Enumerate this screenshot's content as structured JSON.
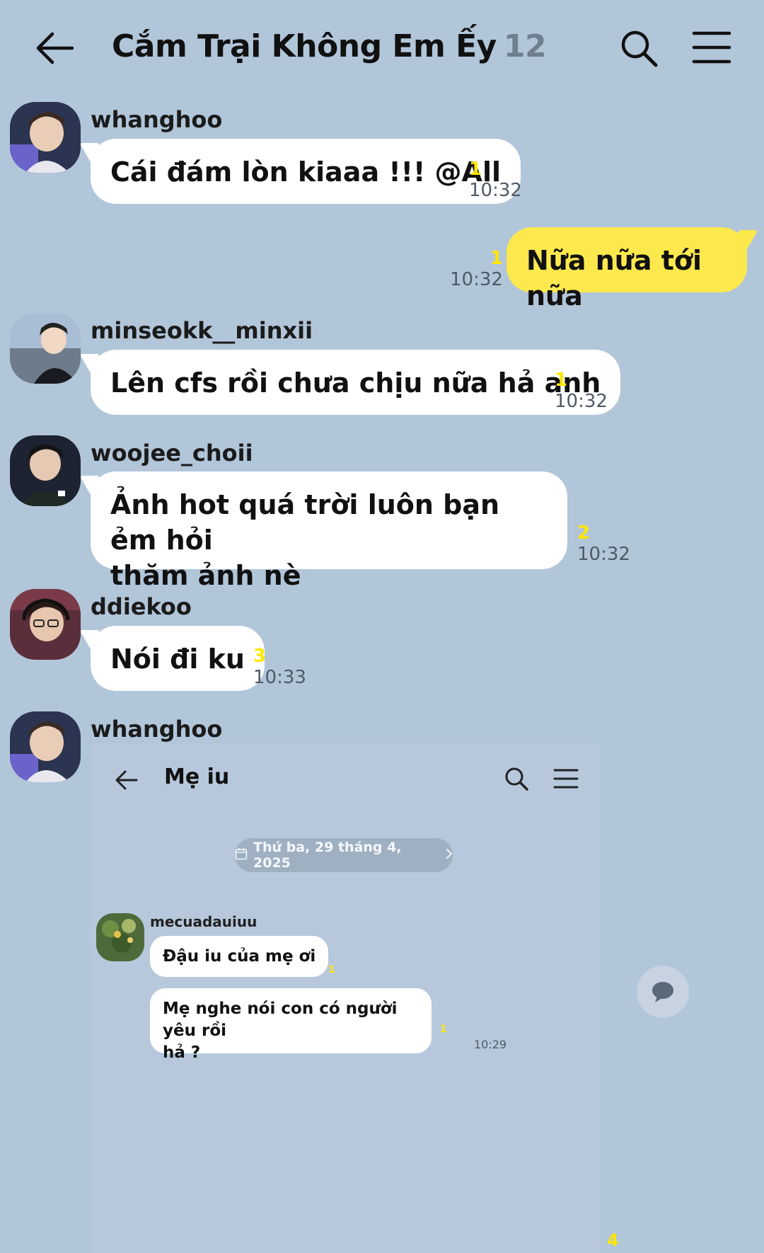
{
  "header": {
    "title": "Cắm Trại Không Em Ếy",
    "member_count": "12",
    "icons": {
      "back": "back-arrow-icon",
      "search": "search-icon",
      "menu": "hamburger-menu-icon"
    }
  },
  "messages": [
    {
      "sender": "whanghoo",
      "text": "Cái đám lòn kiaaa !!! @All",
      "unread": "1",
      "time": "10:32"
    },
    {
      "mine": true,
      "text": "Nữa nữa tới nữa",
      "unread": "1",
      "time": "10:32"
    },
    {
      "sender": "minseokk__minxii",
      "text": "Lên cfs rồi chưa chịu nữa hả anh",
      "unread": "1",
      "time": "10:32"
    },
    {
      "sender": "woojee_choii",
      "text_line1": "Ảnh hot quá trời luôn bạn ẻm hỏi",
      "text_line2": "thăm ảnh nè",
      "unread": "2",
      "time": "10:32"
    },
    {
      "sender": "ddiekoo",
      "text": "Nói đi ku",
      "unread": "3",
      "time": "10:33"
    },
    {
      "sender": "whanghoo",
      "attachment": "image"
    }
  ],
  "shared_image": {
    "title": "Mẹ iu",
    "date": "Thứ ba, 29 tháng 4, 2025",
    "sender": "mecuadauiuu",
    "msg1": "Đậu iu của mẹ ơi",
    "msg1_unread": "1",
    "msg2_line1": "Mẹ nghe nói con có người yêu rồi",
    "msg2_line2": "hả ?",
    "msg2_unread": "1",
    "msg2_time": "10:29",
    "icons": {
      "calendar": "calendar-icon",
      "chevron": "chevron-right-icon",
      "chat": "chat-bubble-icon"
    }
  },
  "last_unread": "4",
  "colors": {
    "background": "#b2c6da",
    "my_bubble": "#fde94d",
    "unread": "#ffe600"
  }
}
